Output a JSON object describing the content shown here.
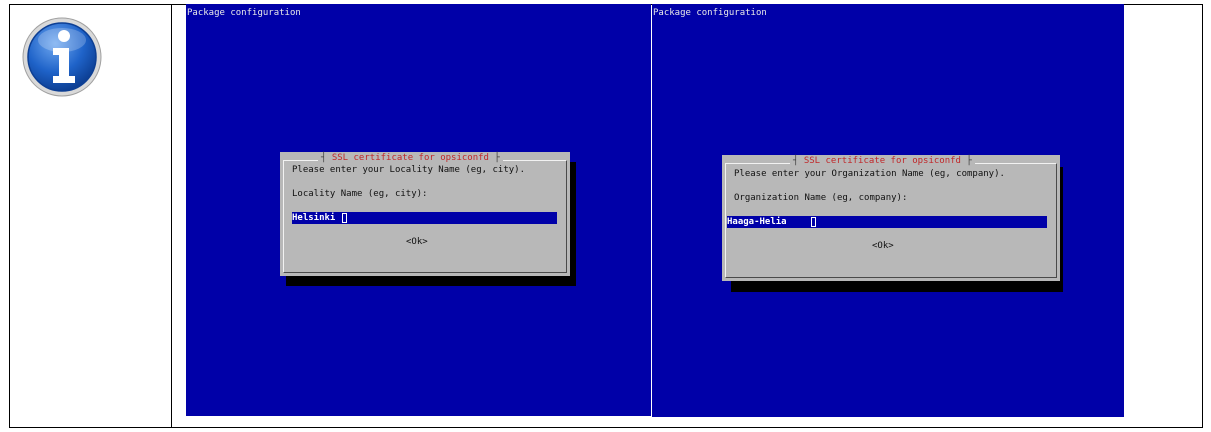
{
  "left_panel": {
    "icon": "info-icon",
    "icon_color": "#1f63c9"
  },
  "screens": [
    {
      "window_title": "Package configuration",
      "dialog_title": "SSL certificate for opsiconfd",
      "prompt": "Please enter your Locality Name (eg, city).",
      "field_label": "Locality Name (eg, city):",
      "field_value": "Helsinki",
      "ok_label": "<Ok>"
    },
    {
      "window_title": "Package configuration",
      "dialog_title": "SSL certificate for opsiconfd",
      "prompt": "Please enter your Organization Name (eg, company).",
      "field_label": "Organization Name (eg, company):",
      "field_value": "Haaga-Helia",
      "ok_label": "<Ok>"
    }
  ],
  "colors": {
    "terminal_bg": "#0000a8",
    "dialog_bg": "#b8b8b8",
    "dialog_title": "#c0282a"
  }
}
